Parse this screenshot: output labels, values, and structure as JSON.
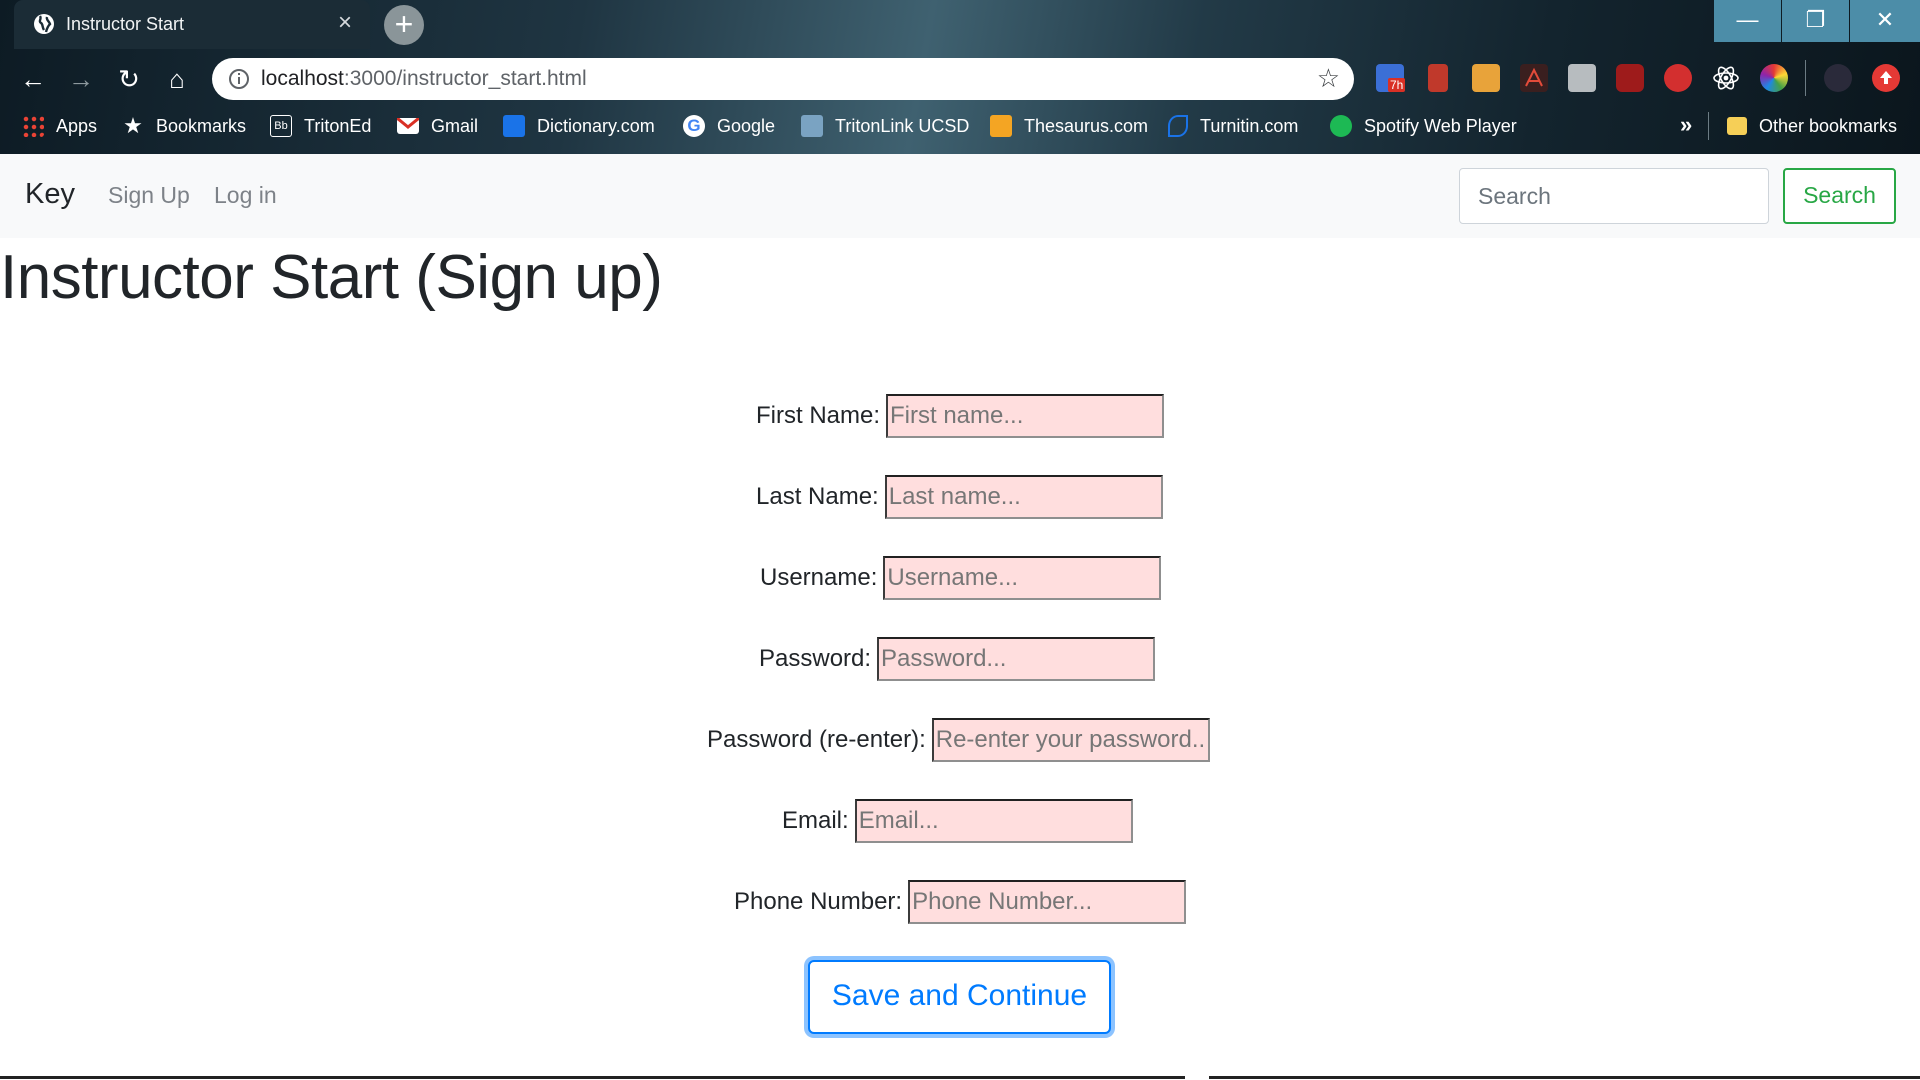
{
  "browser": {
    "tab_title": "Instructor Start",
    "tab_close": "×",
    "new_tab": "+",
    "window_controls": {
      "minimize": "—",
      "maximize": "❐",
      "close": "✕"
    },
    "nav": {
      "back": "←",
      "forward": "→",
      "reload": "↻",
      "home": "⌂"
    },
    "url_host": "localhost",
    "url_path": ":3000/instructor_start.html",
    "star": "☆",
    "bookmarks": [
      {
        "label": "Apps",
        "icon": "apps-grid-icon"
      },
      {
        "label": "Bookmarks",
        "icon": "star-icon"
      },
      {
        "label": "TritonEd",
        "icon": "blackboard-icon"
      },
      {
        "label": "Gmail",
        "icon": "gmail-icon"
      },
      {
        "label": "Dictionary.com",
        "icon": "dictionary-icon"
      },
      {
        "label": "Google",
        "icon": "google-icon"
      },
      {
        "label": "TritonLink UCSD",
        "icon": "tritonlink-icon"
      },
      {
        "label": "Thesaurus.com",
        "icon": "thesaurus-icon"
      },
      {
        "label": "Turnitin.com",
        "icon": "turnitin-icon"
      },
      {
        "label": "Spotify Web Player",
        "icon": "spotify-icon"
      }
    ],
    "bookmarks_more": "»",
    "other_bookmarks": "Other bookmarks",
    "extension_badge": "7h"
  },
  "navbar": {
    "brand": "Key",
    "links": [
      "Sign Up",
      "Log in"
    ],
    "search_placeholder": "Search",
    "search_button": "Search"
  },
  "page": {
    "title": "Instructor Start (Sign up)",
    "fields": [
      {
        "label": "First Name:",
        "placeholder": "First name..."
      },
      {
        "label": "Last Name:",
        "placeholder": "Last name..."
      },
      {
        "label": "Username:",
        "placeholder": "Username..."
      },
      {
        "label": "Password:",
        "placeholder": "Password..."
      },
      {
        "label": "Password (re-enter):",
        "placeholder": "Re-enter your password..."
      },
      {
        "label": "Email:",
        "placeholder": "Email..."
      },
      {
        "label": "Phone Number:",
        "placeholder": "Phone Number..."
      }
    ],
    "submit": "Save and Continue"
  },
  "colors": {
    "input_bg": "#ffdede",
    "success": "#28a745",
    "primary": "#007bff",
    "navbar_bg": "#f8f9fa"
  }
}
